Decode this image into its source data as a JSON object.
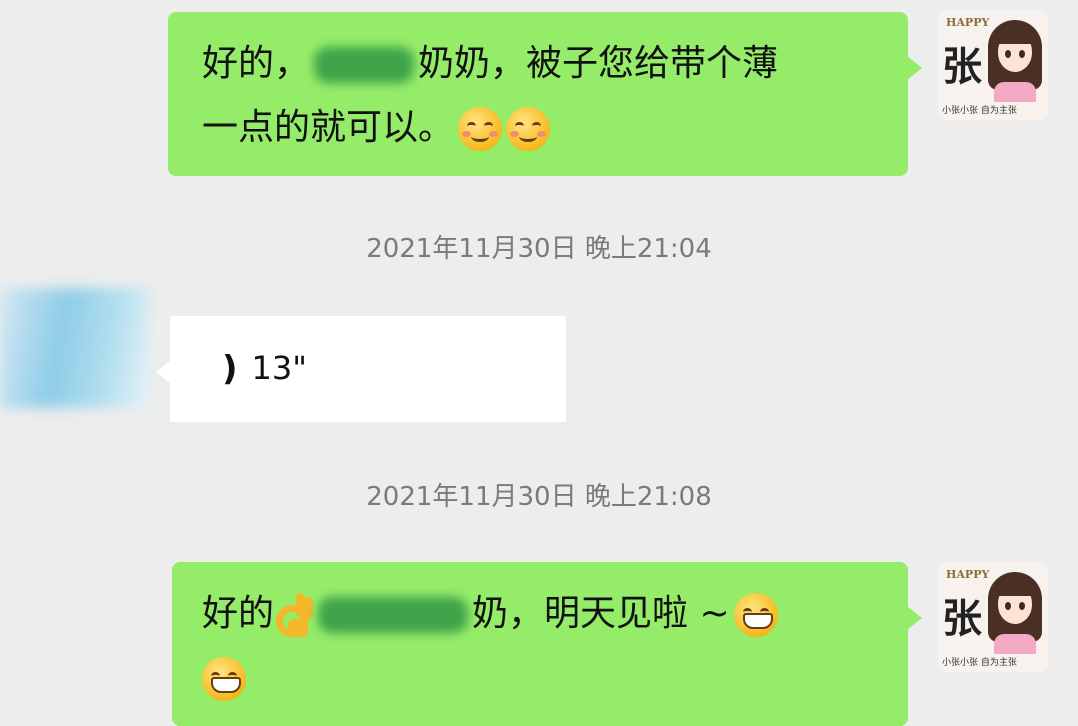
{
  "messages": [
    {
      "type": "text",
      "direction": "outgoing",
      "line1_prefix": "好的，",
      "line1_suffix": "奶奶，被子您给带个薄",
      "line2": "一点的就可以。",
      "emojis": [
        "smiling-face-with-smiling-eyes",
        "smiling-face-with-smiling-eyes"
      ]
    },
    {
      "type": "timestamp",
      "text": "2021年11月30日 晚上21:04"
    },
    {
      "type": "voice",
      "direction": "incoming",
      "duration": "13\""
    },
    {
      "type": "timestamp",
      "text": "2021年11月30日 晚上21:08"
    },
    {
      "type": "text",
      "direction": "outgoing",
      "line1_prefix": "好的",
      "line1_suffix": "奶，明天见啦 ~",
      "emojis": [
        "ok-hand",
        "grinning-face",
        "grinning-face"
      ]
    }
  ],
  "self_avatar": {
    "badge": "HAPPY",
    "character": "张",
    "caption": "小张小张 自为主张"
  },
  "colors": {
    "background": "#ededed",
    "outgoing_bubble": "#95ec69",
    "incoming_bubble": "#ffffff",
    "timestamp": "#7a7a7a"
  }
}
